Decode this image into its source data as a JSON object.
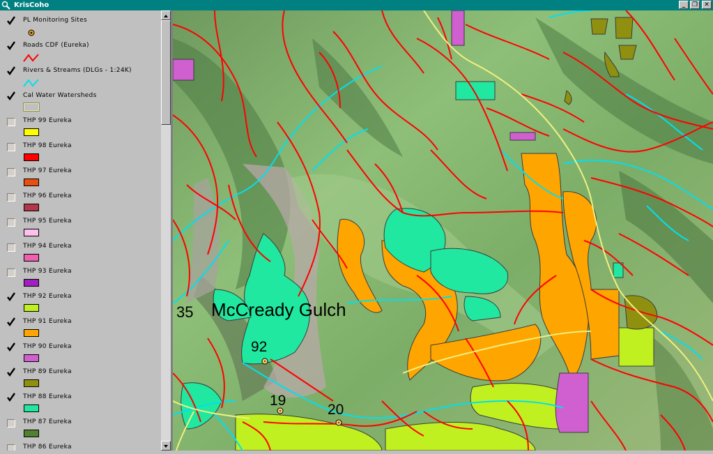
{
  "window": {
    "title": "KrisCoho",
    "buttons": [
      "_",
      "❐",
      "✕"
    ]
  },
  "legend": {
    "items": [
      {
        "label": "PL Monitoring Sites",
        "checked": true,
        "symbol": "point-marker",
        "color": "#e8a020"
      },
      {
        "label": "Roads CDF (Eureka)",
        "checked": true,
        "symbol": "line",
        "color": "#ff0000"
      },
      {
        "label": "Rivers & Streams (DLGs - 1:24K)",
        "checked": true,
        "symbol": "line",
        "color": "#00e0f0"
      },
      {
        "label": "Cal Water Watersheds",
        "checked": true,
        "symbol": "outline",
        "color": "#f0f080"
      },
      {
        "label": "THP 99 Eureka",
        "checked": false,
        "symbol": "fill",
        "color": "#ffff00"
      },
      {
        "label": "THP 98 Eureka",
        "checked": false,
        "symbol": "fill",
        "color": "#ff0000"
      },
      {
        "label": "THP 97 Eureka",
        "checked": false,
        "symbol": "fill",
        "color": "#e85010"
      },
      {
        "label": "THP 96 Eureka",
        "checked": false,
        "symbol": "fill",
        "color": "#b03848"
      },
      {
        "label": "THP 95 Eureka",
        "checked": false,
        "symbol": "fill",
        "color": "#ffc0f0"
      },
      {
        "label": "THP 94 Eureka",
        "checked": false,
        "symbol": "fill",
        "color": "#f060b0"
      },
      {
        "label": "THP 93 Eureka",
        "checked": false,
        "symbol": "fill",
        "color": "#a020c0"
      },
      {
        "label": "THP 92 Eureka",
        "checked": true,
        "symbol": "fill",
        "color": "#c0f020"
      },
      {
        "label": "THP 91 Eureka",
        "checked": true,
        "symbol": "fill",
        "color": "#ffa500"
      },
      {
        "label": "THP 90 Eureka",
        "checked": true,
        "symbol": "fill",
        "color": "#d060d0"
      },
      {
        "label": "THP 89 Eureka",
        "checked": true,
        "symbol": "fill",
        "color": "#909010"
      },
      {
        "label": "THP 88 Eureka",
        "checked": true,
        "symbol": "fill",
        "color": "#20e8a0"
      },
      {
        "label": "THP 87 Eureka",
        "checked": false,
        "symbol": "fill",
        "color": "#508030"
      },
      {
        "label": "THP 86 Eureka",
        "checked": false,
        "symbol": "fill",
        "color": "#a0a0a0"
      }
    ]
  },
  "map": {
    "labels": {
      "watershed": "McCready Gulch",
      "watershed_number": "35"
    },
    "sites": [
      {
        "label": "92"
      },
      {
        "label": "19"
      },
      {
        "label": "20"
      }
    ]
  },
  "colors": {
    "orange_thp": "#ffa500",
    "teal_thp": "#20e8a0",
    "lime_thp": "#c0f020",
    "magenta_thp": "#d060d0",
    "olive_thp": "#909010",
    "road": "#ff0000",
    "stream": "#00e0f0",
    "watershed": "#f0f080"
  }
}
